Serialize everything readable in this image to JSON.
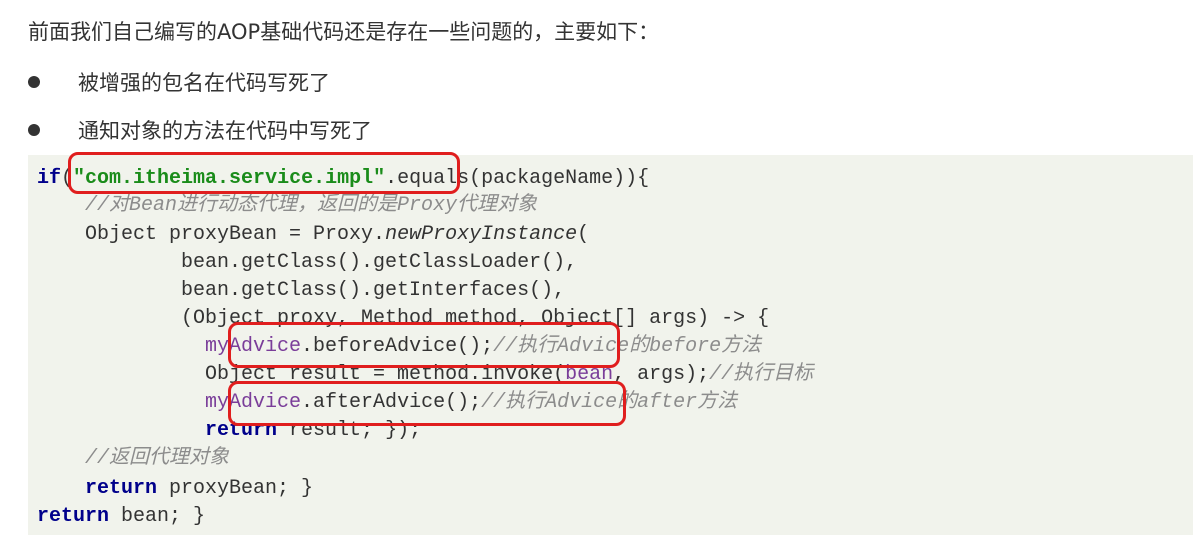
{
  "intro": "前面我们自己编写的AOP基础代码还是存在一些问题的，主要如下：",
  "bullets": [
    "被增强的包名在代码写死了",
    "通知对象的方法在代码中写死了"
  ],
  "code": {
    "l1": {
      "kw": "if",
      "open": "(",
      "str": "\"com.itheima.service.impl\"",
      "rest": ".equals(packageName)){"
    },
    "l2": {
      "indent": "    ",
      "comment": "//对Bean进行动态代理，返回的是Proxy代理对象"
    },
    "l3": {
      "a": "    Object proxyBean = Proxy.",
      "m": "newProxyInstance",
      "b": "("
    },
    "l4": "            bean.getClass().getClassLoader(),",
    "l5": "            bean.getClass().getInterfaces(),",
    "l6": "            (Object proxy, Method method, Object[] args) -> {",
    "l7": {
      "indent": "              ",
      "field": "myAdvice",
      "rest": ".beforeAdvice();",
      "comment": "//执行Advice的before方法"
    },
    "l8": {
      "a": "              Object result = method.invoke(",
      "field": "bean",
      "b": ", args);",
      "comment": "//执行目标"
    },
    "l9": {
      "indent": "              ",
      "field": "myAdvice",
      "rest": ".afterAdvice();",
      "comment": "//执行Advice的after方法"
    },
    "l10": {
      "indent": "              ",
      "kw": "return",
      "rest": " result; });"
    },
    "l11": {
      "indent": "    ",
      "comment": "//返回代理对象"
    },
    "l12": {
      "indent": "    ",
      "kw": "return",
      "rest": " proxyBean; }"
    },
    "l13": {
      "kw": "return",
      "rest": " bean; }"
    }
  },
  "colors": {
    "highlight": "#e01e1e",
    "keyword": "#00008b",
    "string": "#1a8c1a",
    "comment": "#8c8c8c",
    "field": "#7a3d99",
    "code_bg": "#f1f3ec"
  }
}
